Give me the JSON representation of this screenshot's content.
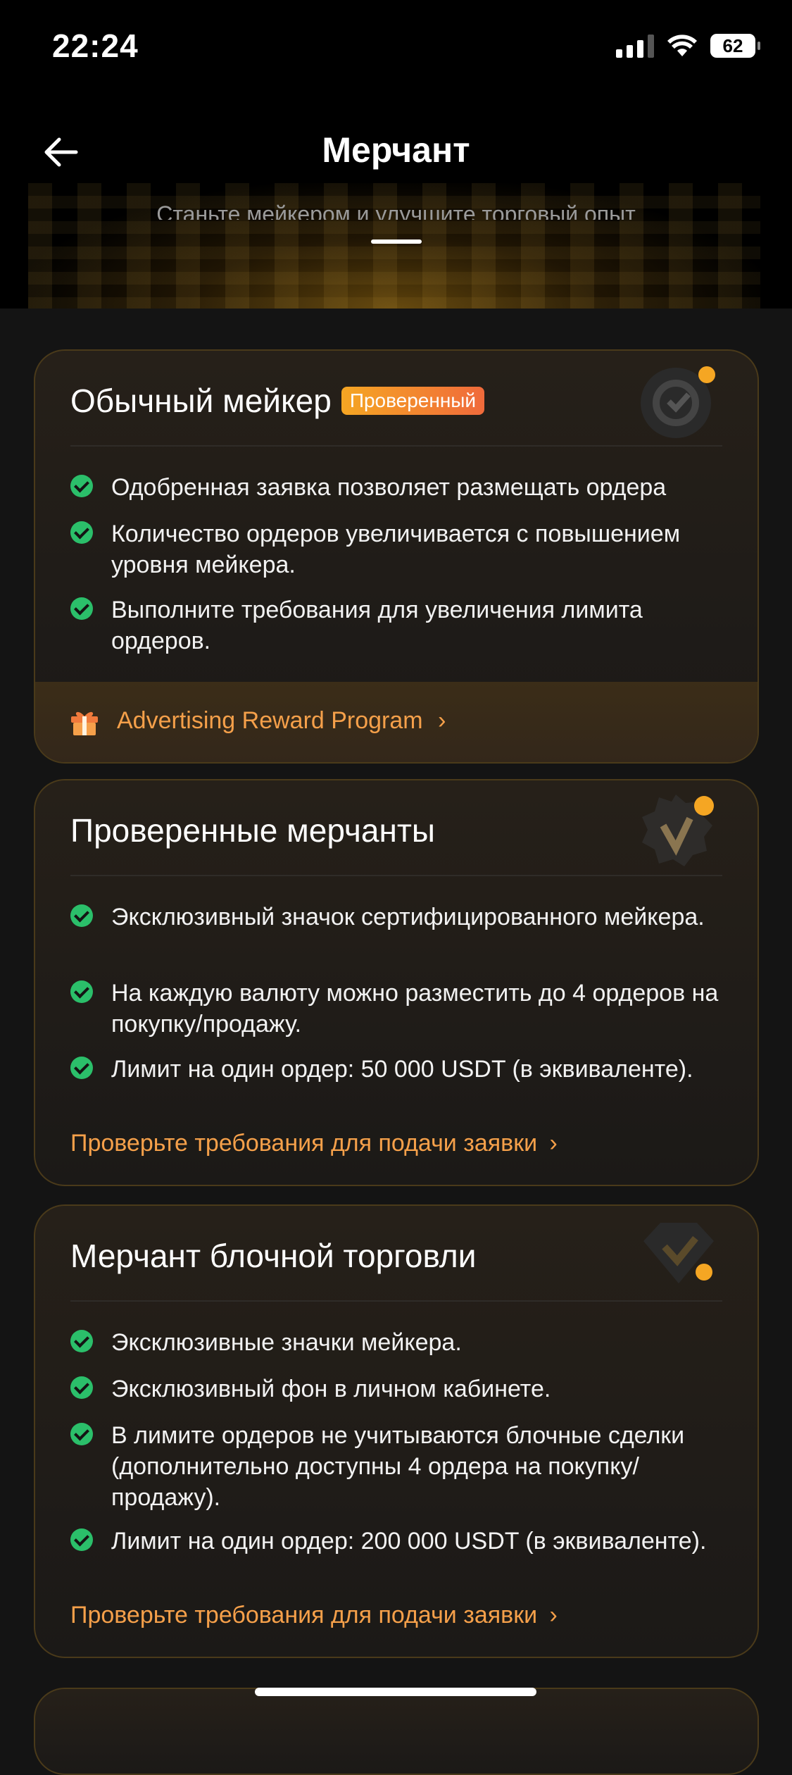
{
  "status_bar": {
    "time": "22:24",
    "battery": "62"
  },
  "header": {
    "title": "Мерчант",
    "hero_subtitle": "Станьте мейкером и улучшите торговый опыт"
  },
  "cards": [
    {
      "title": "Обычный мейкер",
      "badge": "Проверенный",
      "features": [
        "Одобренная заявка позволяет размещать ордера",
        "Количество ордеров увеличивается с повышением уровня мейкера.",
        "Выполните требования для увеличения лимита ордеров."
      ],
      "reward_link": "Advertising Reward Program",
      "icon": "refresh-check-icon"
    },
    {
      "title": "Проверенные мерчанты",
      "features": [
        "Эксклюзивный значок сертифицированного мейкера.",
        "На каждую валюту можно разместить до 4 ордеров на покупку/продажу.",
        "Лимит на один ордер: 50 000 USDT (в эквиваленте)."
      ],
      "link": "Проверьте требования для подачи заявки",
      "icon": "verified-badge-icon"
    },
    {
      "title": "Мерчант блочной торговли",
      "features": [
        "Эксклюзивные значки мейкера.",
        "Эксклюзивный фон в личном кабинете.",
        "В лимите ордеров не учитываются блочные сделки (дополнительно доступны 4 ордера на покупку/продажу).",
        "Лимит на один ордер: 200 000 USDT (в эквиваленте)."
      ],
      "link": "Проверьте требования для подачи заявки",
      "icon": "diamond-check-icon"
    }
  ],
  "colors": {
    "accent": "#f5a04a",
    "check": "#2bbf6a",
    "badge": "#f5a623"
  }
}
